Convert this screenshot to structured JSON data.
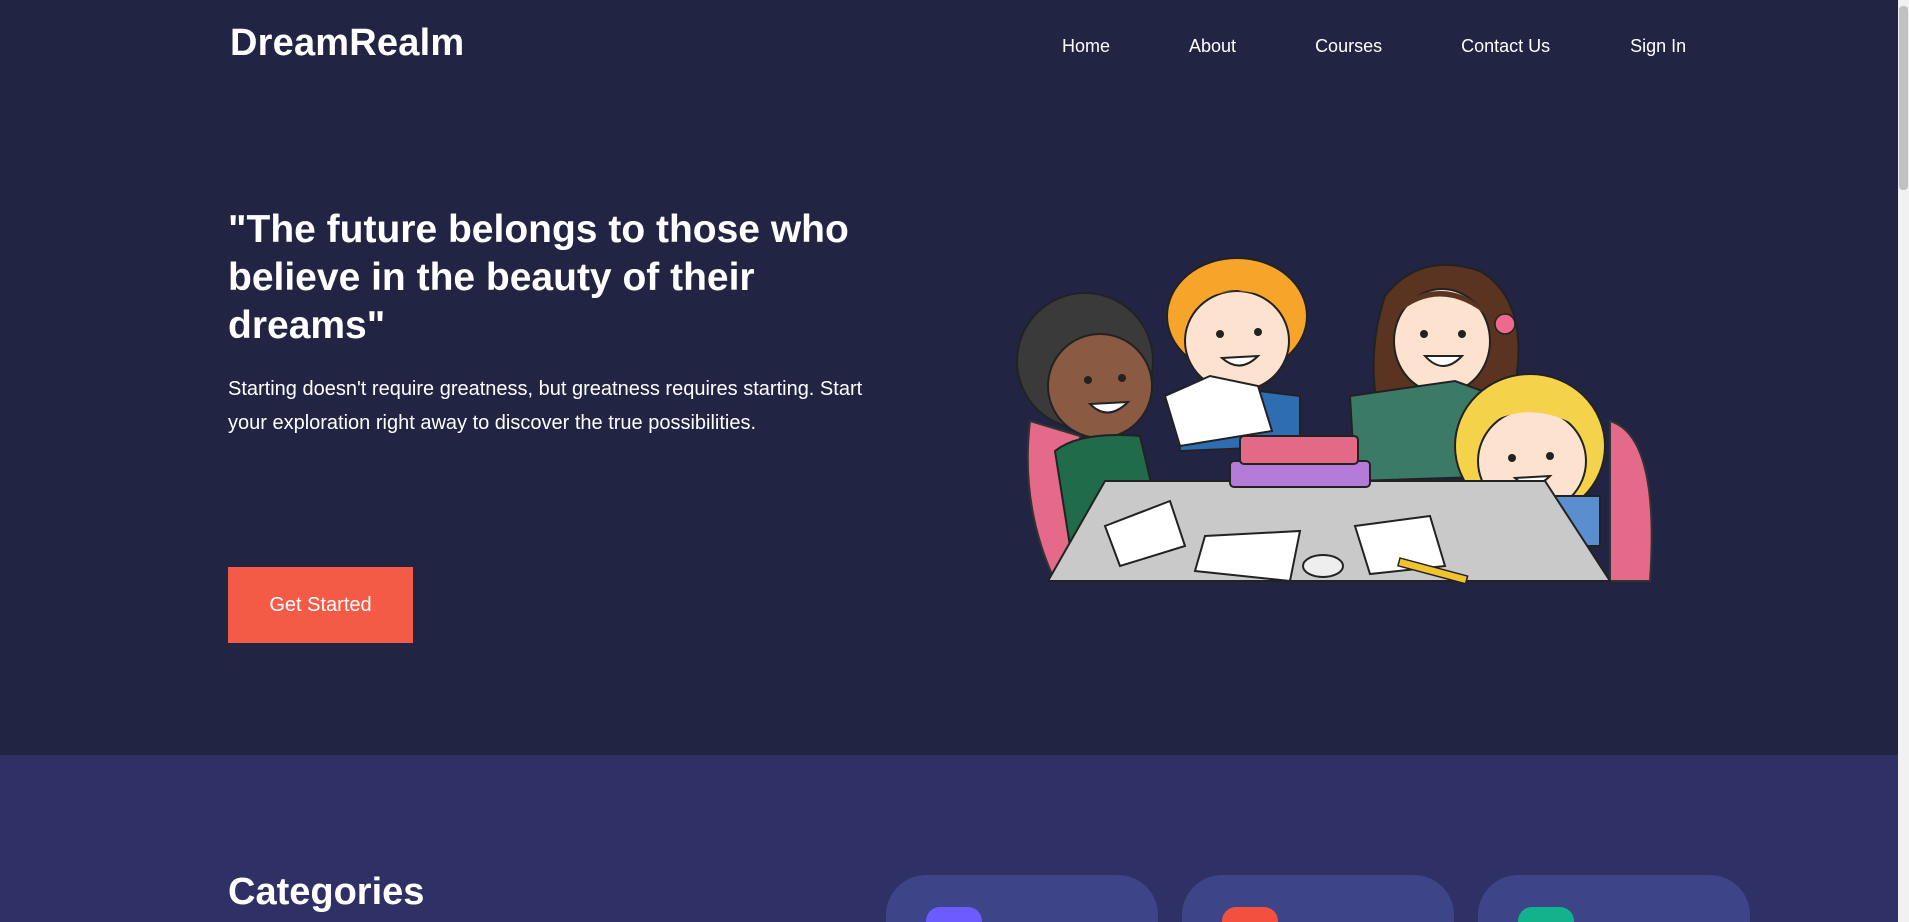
{
  "brand": {
    "name": "DreamRealm"
  },
  "nav": {
    "items": [
      {
        "label": "Home"
      },
      {
        "label": "About"
      },
      {
        "label": "Courses"
      },
      {
        "label": "Contact Us"
      },
      {
        "label": "Sign In"
      }
    ]
  },
  "hero": {
    "title": "\"The future belongs to those who believe in the beauty of their dreams\"",
    "subtitle": "Starting doesn't require greatness, but greatness requires starting. Start your exploration right away to discover the true possibilities.",
    "cta_label": "Get Started",
    "illustration_icon": "kids-studying-illustration"
  },
  "categories": {
    "title": "Categories",
    "cards": [
      {
        "icon_color": "#6c5cff"
      },
      {
        "icon_color": "#f4503f"
      },
      {
        "icon_color": "#12b28c"
      }
    ]
  },
  "colors": {
    "background": "#212543",
    "band": "#2f3166",
    "card": "#3d4487",
    "accent": "#f45b47"
  }
}
